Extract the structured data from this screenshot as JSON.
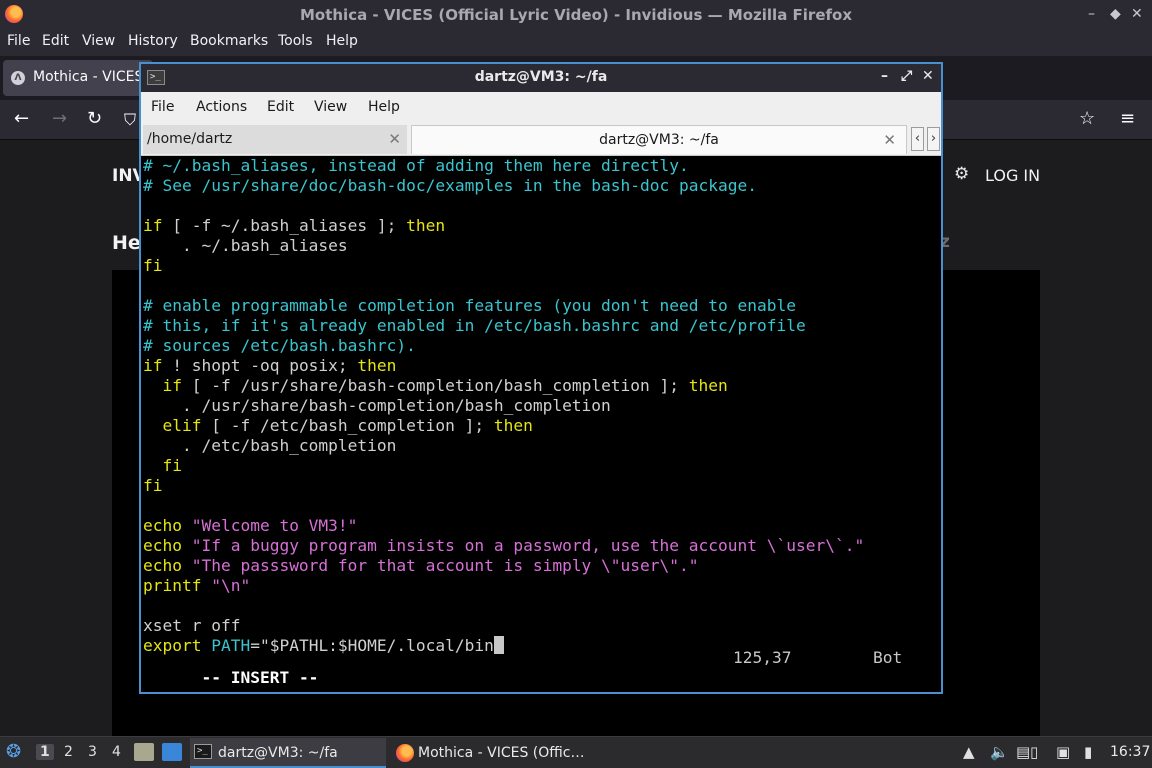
{
  "firefox": {
    "window_title": "Mothica - VICES (Official Lyric Video) - Invidious — Mozilla Firefox",
    "menu": [
      "File",
      "Edit",
      "View",
      "History",
      "Bookmarks",
      "Tools",
      "Help"
    ],
    "tab_title": "Mothica - VICES",
    "page": {
      "brand": "INV",
      "heading": "He",
      "heading_right": "z",
      "login": "LOG IN"
    }
  },
  "terminal": {
    "title": "dartz@VM3: ~/fa",
    "menu": [
      "File",
      "Actions",
      "Edit",
      "View",
      "Help"
    ],
    "tabs": [
      "/home/dartz",
      "dartz@VM3: ~/fa"
    ],
    "lines": [
      [
        [
          "c",
          "# ~/.bash_aliases, instead of adding them here directly."
        ]
      ],
      [
        [
          "c",
          "# See /usr/share/doc/bash-doc/examples in the bash-doc package."
        ]
      ],
      [],
      [
        [
          "y",
          "if"
        ],
        [
          "w",
          " [ -f ~/.bash_aliases ]; "
        ],
        [
          "y",
          "then"
        ]
      ],
      [
        [
          "w",
          "    . ~/.bash_aliases"
        ]
      ],
      [
        [
          "y",
          "fi"
        ]
      ],
      [],
      [
        [
          "c",
          "# enable programmable completion features (you don't need to enable"
        ]
      ],
      [
        [
          "c",
          "# this, if it's already enabled in /etc/bash.bashrc and /etc/profile"
        ]
      ],
      [
        [
          "c",
          "# sources /etc/bash.bashrc)."
        ]
      ],
      [
        [
          "y",
          "if"
        ],
        [
          "w",
          " ! shopt -oq posix; "
        ],
        [
          "y",
          "then"
        ]
      ],
      [
        [
          "w",
          "  "
        ],
        [
          "y",
          "if"
        ],
        [
          "w",
          " [ -f /usr/share/bash-completion/bash_completion ]; "
        ],
        [
          "y",
          "then"
        ]
      ],
      [
        [
          "w",
          "    . /usr/share/bash-completion/bash_completion"
        ]
      ],
      [
        [
          "w",
          "  "
        ],
        [
          "y",
          "elif"
        ],
        [
          "w",
          " [ -f /etc/bash_completion ]; "
        ],
        [
          "y",
          "then"
        ]
      ],
      [
        [
          "w",
          "    . /etc/bash_completion"
        ]
      ],
      [
        [
          "w",
          "  "
        ],
        [
          "y",
          "fi"
        ]
      ],
      [
        [
          "y",
          "fi"
        ]
      ],
      [],
      [
        [
          "y",
          "echo"
        ],
        [
          "w",
          " "
        ],
        [
          "m",
          "\"Welcome to VM3!\""
        ]
      ],
      [
        [
          "y",
          "echo"
        ],
        [
          "w",
          " "
        ],
        [
          "m",
          "\"If a buggy program insists on a password, use the account \\`user\\`.\""
        ]
      ],
      [
        [
          "y",
          "echo"
        ],
        [
          "w",
          " "
        ],
        [
          "m",
          "\"The passsword for that account is simply \\\"user\\\".\""
        ]
      ],
      [
        [
          "y",
          "printf"
        ],
        [
          "w",
          " "
        ],
        [
          "m",
          "\"\\n\""
        ]
      ],
      [],
      [
        [
          "w",
          "xset r off"
        ]
      ],
      [
        [
          "y",
          "export"
        ],
        [
          "w",
          " "
        ],
        [
          "c",
          "PATH"
        ],
        [
          "w",
          "=\"$PATHL:$HOME/.local/bin"
        ]
      ]
    ],
    "status": {
      "mode": "-- INSERT --",
      "position": "125,37",
      "scroll": "Bot"
    }
  },
  "taskbar": {
    "workspaces": [
      "1",
      "2",
      "3",
      "4"
    ],
    "tasks": [
      "dartz@VM3: ~/fa",
      "Mothica - VICES (Offic…"
    ],
    "clock": "16:37"
  }
}
